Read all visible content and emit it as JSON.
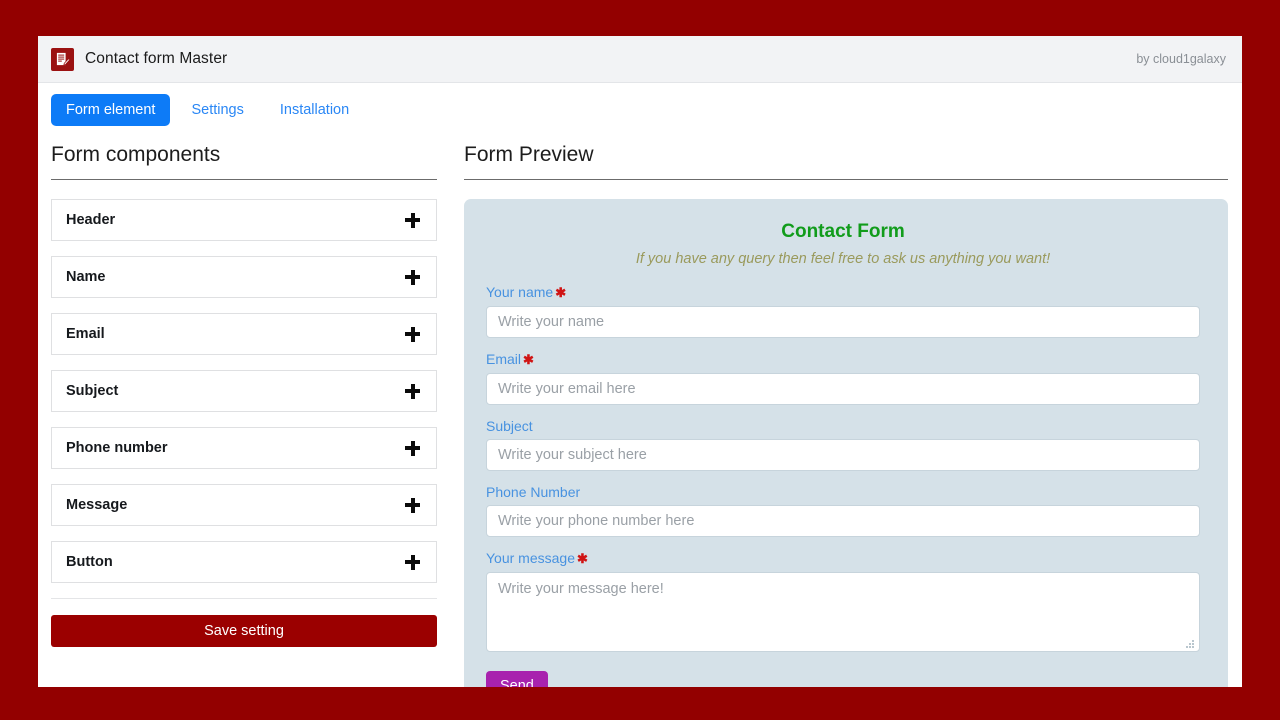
{
  "window": {
    "title": "Contact form Master",
    "attribution": "by cloud1galaxy",
    "app_icon": "form-document-pencil-icon"
  },
  "tabs": [
    {
      "label": "Form element",
      "active": true
    },
    {
      "label": "Settings",
      "active": false
    },
    {
      "label": "Installation",
      "active": false
    }
  ],
  "left_panel": {
    "heading": "Form components",
    "components": [
      {
        "label": "Header",
        "add_icon": "plus-icon"
      },
      {
        "label": "Name",
        "add_icon": "plus-icon"
      },
      {
        "label": "Email",
        "add_icon": "plus-icon"
      },
      {
        "label": "Subject",
        "add_icon": "plus-icon"
      },
      {
        "label": "Phone number",
        "add_icon": "plus-icon"
      },
      {
        "label": "Message",
        "add_icon": "plus-icon"
      },
      {
        "label": "Button",
        "add_icon": "plus-icon"
      }
    ],
    "save_button": "Save setting"
  },
  "right_panel": {
    "heading": "Form Preview",
    "form": {
      "title": "Contact Form",
      "subtitle": "If you have any query then feel free to ask us anything you want!",
      "fields": [
        {
          "label": "Your name",
          "required": true,
          "placeholder": "Write your name",
          "value": ""
        },
        {
          "label": "Email",
          "required": true,
          "placeholder": "Write your email here",
          "value": ""
        },
        {
          "label": "Subject",
          "required": false,
          "placeholder": "Write your subject here",
          "value": ""
        },
        {
          "label": "Phone Number",
          "required": false,
          "placeholder": "Write your phone number here",
          "value": ""
        },
        {
          "label": "Your message",
          "required": true,
          "placeholder": "Write your message here!",
          "value": ""
        }
      ],
      "submit_label": "Send"
    }
  },
  "colors": {
    "page_background": "#930000",
    "title_bar": "#f2f3f5",
    "active_tab": "#0d7bf7",
    "tab_link": "#2a87f5",
    "save_button": "#9b0000",
    "preview_background": "#d5e1e8",
    "form_title": "#119c1b",
    "form_subtitle": "#9a9a5c",
    "field_label": "#4892e0",
    "required_star": "#d01414",
    "send_button": "#a822ae"
  }
}
